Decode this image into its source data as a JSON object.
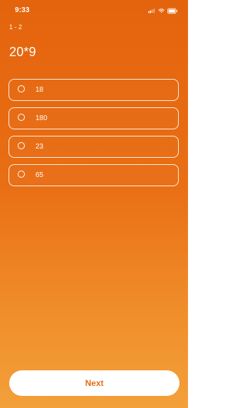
{
  "status_bar": {
    "time": "9:33",
    "signal_icon": "signal-icon",
    "wifi_icon": "wifi-icon",
    "battery_icon": "battery-icon"
  },
  "quiz": {
    "progress": "1 - 2",
    "question": "20*9",
    "options": [
      {
        "label": "18"
      },
      {
        "label": "180"
      },
      {
        "label": "23"
      },
      {
        "label": "65"
      }
    ]
  },
  "footer": {
    "next_label": "Next"
  },
  "colors": {
    "background_top": "#e4640d",
    "background_bottom": "#f3a03a",
    "button_text": "#e86d16"
  }
}
